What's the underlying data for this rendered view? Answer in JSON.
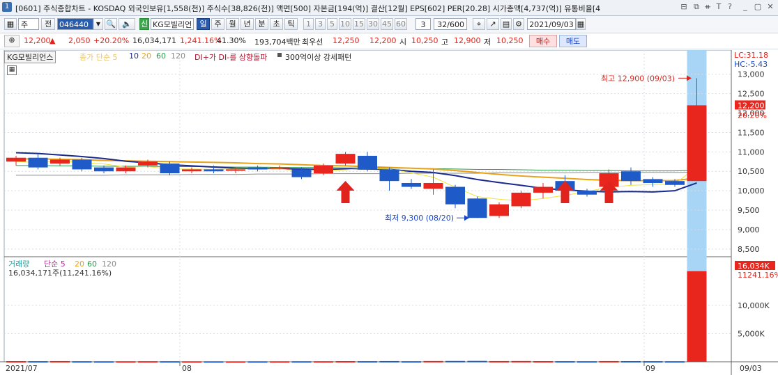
{
  "window": {
    "number": "1",
    "title": "[0601] 주식종합차트 - KOSDAQ 외국인보유[1,558(천)] 주식수[38,826(천)] 액면[500] 자본금[194(억)] 결산[12월] EPS[602] PER[20.28] 시가총액[4,737(억)] 유통비율[4",
    "controls": [
      "⊟",
      "⧉",
      "ᚑ",
      "T",
      "?",
      "_",
      "▢",
      "✕"
    ]
  },
  "toolbar": {
    "period_select": "주",
    "prev_label": "전",
    "code": "046440",
    "new_label": "신",
    "stock_name": "KG모빌리언",
    "tabs": [
      "일",
      "주",
      "월",
      "년",
      "분",
      "초",
      "틱"
    ],
    "active_tab": "일",
    "intervals": [
      "1",
      "3",
      "5",
      "10",
      "15",
      "30",
      "45",
      "60"
    ],
    "interval_select": "3",
    "page_count": "32/600",
    "date": "2021/09/03"
  },
  "price": {
    "current": "12,200",
    "change": "2,050",
    "change_pct": "+20.20%",
    "volume": "16,034,171",
    "volume_ratio": "1,241.16%",
    "turnover": "41.30%",
    "amount": "193,704백만",
    "best_bid_label": "최우선",
    "best_bid": "12,250",
    "best_ask": "12,200",
    "open_label": "시",
    "open": "10,250",
    "high_label": "고",
    "high": "12,900",
    "low_label": "저",
    "low": "10,250",
    "buy_label": "매수",
    "sell_label": "매도"
  },
  "legend": {
    "name": "KG모빌리언스",
    "ma_label": "종가 단순 5",
    "ma_periods": [
      "10",
      "20",
      "60",
      "120"
    ],
    "signal1": "DI+가 DI-를 상향돌파",
    "signal2": "300억이상 강세패턴",
    "lc": "LC:31.18",
    "hc": "HC:-5.43"
  },
  "annotations": {
    "high": "최고 12,900 (09/03)",
    "low": "최저 9,300 (08/20)"
  },
  "volume_panel": {
    "title": "거래량",
    "ma_label": "단순 5",
    "ma_periods": [
      "20",
      "60",
      "120"
    ],
    "value_text": "16,034,171주(11,241.16%)",
    "badge": "16,034K",
    "pct": "11241.16%"
  },
  "colors": {
    "up": "#e8261d",
    "down": "#1e5ac8",
    "highlight": "#a8d4f5",
    "ma5": "#f2e23a",
    "ma10": "#1a2a8c",
    "ma20": "#e8a21a",
    "ma60": "#2a9a4a",
    "ma120": "#8a8a8a",
    "arrow": "#e0231c"
  },
  "chart_data": {
    "type": "candlestick",
    "x_labels": [
      "2021/07",
      "08",
      "09",
      "09/03"
    ],
    "y_ticks": [
      8500,
      9000,
      9500,
      10000,
      10500,
      11000,
      11500,
      12000,
      12500,
      13000
    ],
    "ylim": [
      8300,
      13300
    ],
    "current_price_label": "12,200",
    "current_pct_label": "20.20%",
    "volume_ticks": [
      "5,000K",
      "10,000K"
    ],
    "volume_ylim": [
      0,
      17000000
    ],
    "candles": [
      {
        "o": 10750,
        "c": 10850,
        "h": 10900,
        "l": 10650
      },
      {
        "o": 10850,
        "c": 10600,
        "h": 10950,
        "l": 10550
      },
      {
        "o": 10700,
        "c": 10800,
        "h": 10850,
        "l": 10650
      },
      {
        "o": 10800,
        "c": 10550,
        "h": 10850,
        "l": 10500
      },
      {
        "o": 10600,
        "c": 10500,
        "h": 10650,
        "l": 10450
      },
      {
        "o": 10500,
        "c": 10600,
        "h": 10650,
        "l": 10450
      },
      {
        "o": 10650,
        "c": 10750,
        "h": 10800,
        "l": 10600
      },
      {
        "o": 10700,
        "c": 10450,
        "h": 10750,
        "l": 10400
      },
      {
        "o": 10500,
        "c": 10550,
        "h": 10600,
        "l": 10450
      },
      {
        "o": 10550,
        "c": 10500,
        "h": 10650,
        "l": 10450
      },
      {
        "o": 10550,
        "c": 10550,
        "h": 10600,
        "l": 10450
      },
      {
        "o": 10600,
        "c": 10550,
        "h": 10650,
        "l": 10500
      },
      {
        "o": 10600,
        "c": 10600,
        "h": 10650,
        "l": 10550
      },
      {
        "o": 10550,
        "c": 10350,
        "h": 10600,
        "l": 10300
      },
      {
        "o": 10450,
        "c": 10650,
        "h": 10700,
        "l": 10400
      },
      {
        "o": 10700,
        "c": 10950,
        "h": 11000,
        "l": 10650
      },
      {
        "o": 10900,
        "c": 10550,
        "h": 11000,
        "l": 10500
      },
      {
        "o": 10550,
        "c": 10250,
        "h": 10600,
        "l": 10000
      },
      {
        "o": 10200,
        "c": 10100,
        "h": 10300,
        "l": 10050
      },
      {
        "o": 10050,
        "c": 10200,
        "h": 10550,
        "l": 9900
      },
      {
        "o": 10100,
        "c": 9650,
        "h": 10150,
        "l": 9550
      },
      {
        "o": 9800,
        "c": 9300,
        "h": 9850,
        "l": 9300
      },
      {
        "o": 9350,
        "c": 9650,
        "h": 9700,
        "l": 9300
      },
      {
        "o": 9600,
        "c": 9950,
        "h": 10000,
        "l": 9550
      },
      {
        "o": 9950,
        "c": 10100,
        "h": 10200,
        "l": 9800
      },
      {
        "o": 10250,
        "c": 10000,
        "h": 10400,
        "l": 9950
      },
      {
        "o": 10000,
        "c": 9900,
        "h": 10050,
        "l": 9850
      },
      {
        "o": 10100,
        "c": 10450,
        "h": 10550,
        "l": 10000
      },
      {
        "o": 10500,
        "c": 10250,
        "h": 10600,
        "l": 10150
      },
      {
        "o": 10300,
        "c": 10200,
        "h": 10350,
        "l": 10100
      },
      {
        "o": 10250,
        "c": 10150,
        "h": 10300,
        "l": 10100
      },
      {
        "o": 10250,
        "c": 12200,
        "h": 12900,
        "l": 10250
      }
    ],
    "volume": [
      120000,
      110000,
      130000,
      100000,
      90000,
      95000,
      105000,
      100000,
      90000,
      85000,
      80000,
      85000,
      90000,
      95000,
      100000,
      120000,
      110000,
      130000,
      100000,
      140000,
      150000,
      160000,
      130000,
      140000,
      120000,
      110000,
      100000,
      130000,
      120000,
      110000,
      100000,
      16034171
    ],
    "ma5": [
      10750,
      10730,
      10760,
      10730,
      10690,
      10610,
      10620,
      10560,
      10560,
      10550,
      10560,
      10550,
      10560,
      10510,
      10520,
      10540,
      10570,
      10560,
      10460,
      10350,
      10090,
      9850,
      9780,
      9740,
      9800,
      9880,
      9980,
      10090,
      10140,
      10160,
      10170,
      10620
    ],
    "ma10": [
      10980,
      10960,
      10920,
      10880,
      10830,
      10760,
      10720,
      10670,
      10640,
      10610,
      10580,
      10570,
      10570,
      10560,
      10550,
      10560,
      10560,
      10550,
      10500,
      10470,
      10390,
      10290,
      10210,
      10140,
      10060,
      10020,
      9990,
      9970,
      9980,
      9970,
      10000,
      10200
    ],
    "ma20": [
      10820,
      10820,
      10810,
      10800,
      10780,
      10770,
      10760,
      10750,
      10740,
      10730,
      10720,
      10700,
      10690,
      10670,
      10650,
      10640,
      10620,
      10600,
      10580,
      10560,
      10520,
      10470,
      10420,
      10380,
      10350,
      10320,
      10290,
      10270,
      10260,
      10260,
      10260,
      10330
    ],
    "ma60": [
      10650,
      10650,
      10640,
      10640,
      10630,
      10630,
      10630,
      10620,
      10620,
      10620,
      10610,
      10610,
      10600,
      10600,
      10600,
      10590,
      10590,
      10580,
      10580,
      10570,
      10560,
      10550,
      10550,
      10540,
      10530,
      10530,
      10520,
      10520,
      10510,
      10510,
      10510,
      10530
    ],
    "ma120": [
      10400,
      10400,
      10400,
      10400,
      10400,
      10410,
      10410,
      10410,
      10420,
      10420,
      10420,
      10430,
      10430,
      10430,
      10440,
      10440,
      10440,
      10440,
      10450,
      10450,
      10450,
      10450,
      10460,
      10460,
      10460,
      10460,
      10470,
      10470,
      10470,
      10470,
      10470,
      10480
    ],
    "signal_arrows": [
      15,
      25,
      27
    ]
  }
}
